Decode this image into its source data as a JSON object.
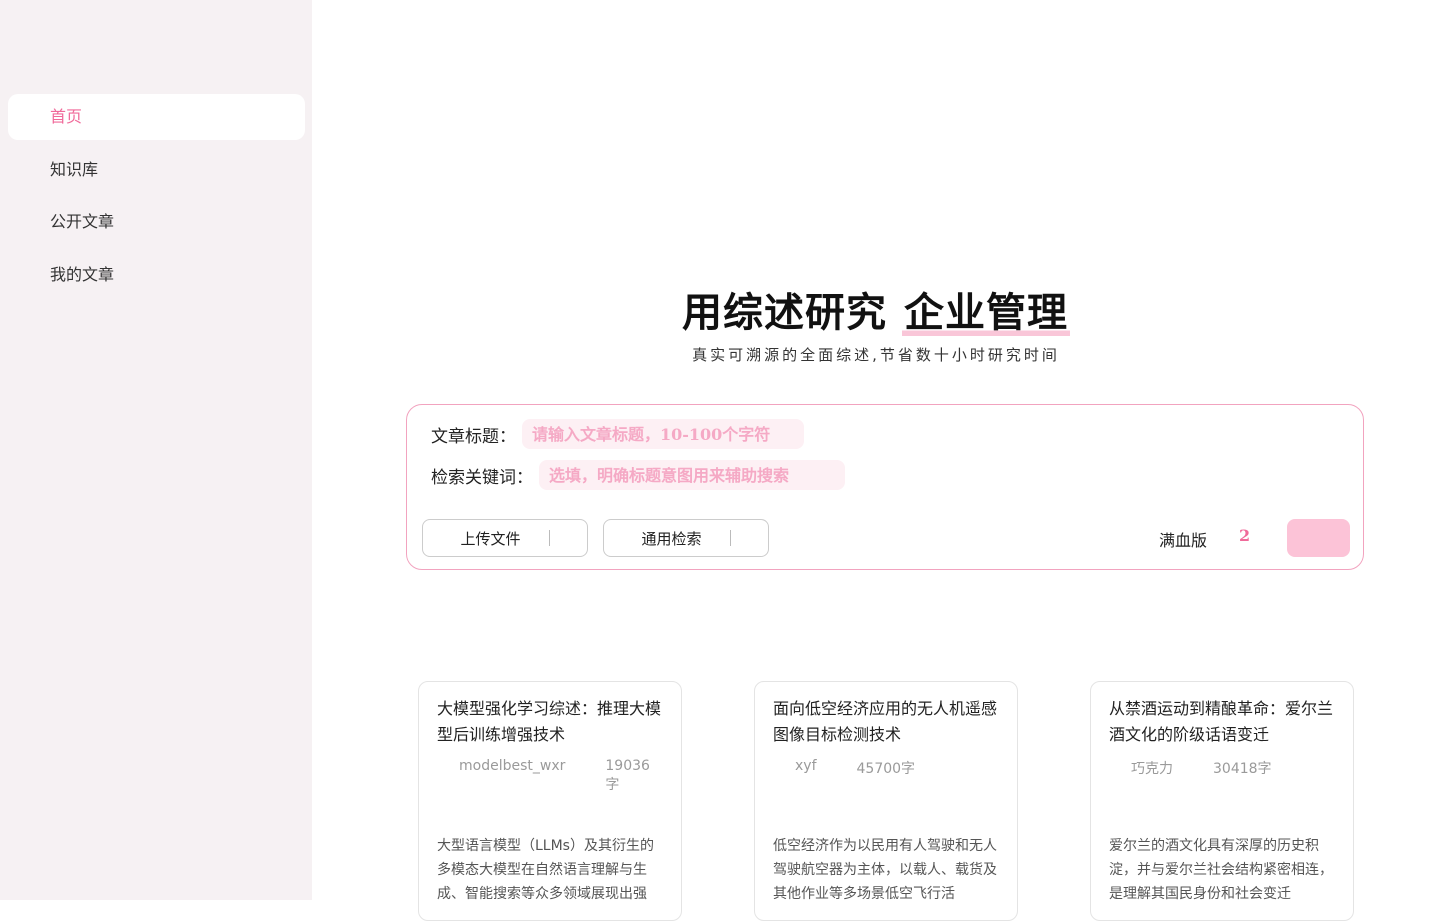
{
  "sidebar": {
    "items": [
      {
        "label": "首页",
        "active": true
      },
      {
        "label": "知识库",
        "active": false
      },
      {
        "label": "公开文章",
        "active": false
      },
      {
        "label": "我的文章",
        "active": false
      }
    ]
  },
  "hero": {
    "title_prefix": "用综述研究 ",
    "title_highlight": "企业管理",
    "subtitle": "真实可溯源的全面综述,节省数十小时研究时间"
  },
  "search": {
    "title_label": "文章标题：",
    "title_placeholder": "请输入文章标题，10-100个字符",
    "keywords_label": "检索关键词：",
    "keywords_placeholder": "选填，明确标题意图用来辅助搜索",
    "upload_label": "上传文件",
    "retrieval_label": "通用检索",
    "mode_label": "满血版",
    "mode_count": "2"
  },
  "cards": [
    {
      "title": "大模型强化学习综述：推理大模型后训练增强技术",
      "author": "modelbest_wxr",
      "word_count": "19036字",
      "abstract": "大型语言模型（LLMs）及其衍生的多模态大模型在自然语言理解与生成、智能搜索等众多领域展现出强"
    },
    {
      "title": "面向低空经济应用的无人机遥感图像目标检测技术",
      "author": "xyf",
      "word_count": "45700字",
      "abstract": "低空经济作为以民用有人驾驶和无人驾驶航空器为主体，以载人、载货及其他作业等多场景低空飞行活"
    },
    {
      "title": "从禁酒运动到精酿革命：爱尔兰酒文化的阶级话语变迁",
      "author": "巧克力",
      "word_count": "30418字",
      "abstract": "爱尔兰的酒文化具有深厚的历史积淀，并与爱尔兰社会结构紧密相连，是理解其国民身份和社会变迁"
    }
  ],
  "colors": {
    "accent": "#f06a9a",
    "accent_light": "#fcc3d7",
    "sidebar_bg": "#f6f1f3"
  }
}
